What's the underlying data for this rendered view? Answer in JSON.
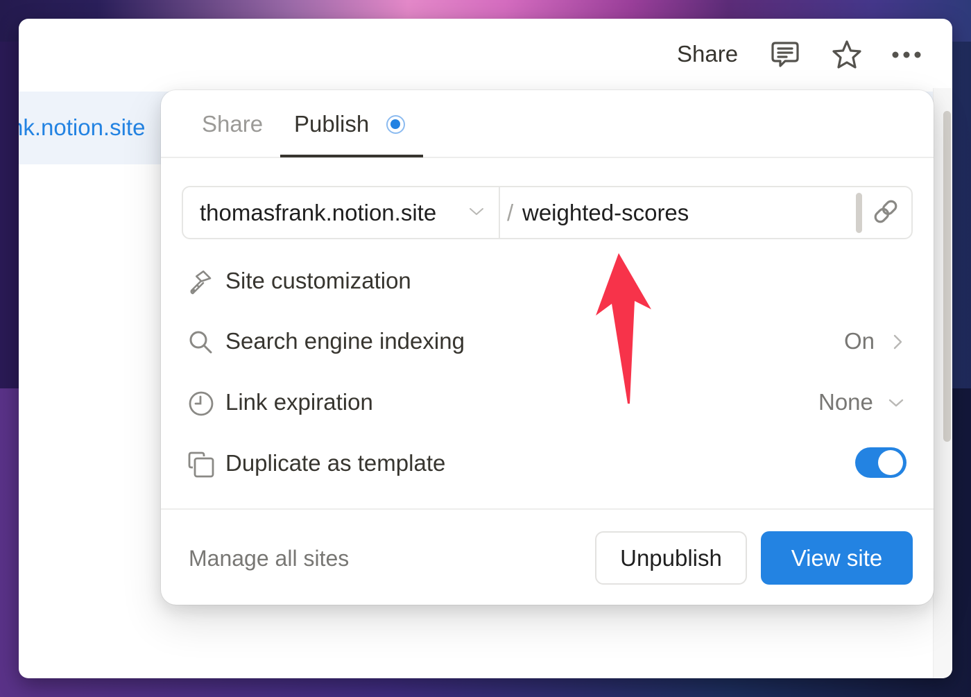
{
  "topbar": {
    "share_label": "Share",
    "icons": [
      "comment-icon",
      "star-icon",
      "more-icon"
    ]
  },
  "page": {
    "visible_link_fragment": "nk.notion.site"
  },
  "popover": {
    "tabs": [
      {
        "label": "Share",
        "active": false
      },
      {
        "label": "Publish",
        "active": true,
        "status": "published-indicator"
      }
    ],
    "url": {
      "domain": "thomasfrank.notion.site",
      "separator": "/",
      "slug": "weighted-scores",
      "copy_icon": "link-icon"
    },
    "options": [
      {
        "icon": "paintbrush-icon",
        "label": "Site customization"
      },
      {
        "icon": "search-icon",
        "label": "Search engine indexing",
        "value": "On",
        "control": "chevron-right"
      },
      {
        "icon": "clock-icon",
        "label": "Link expiration",
        "value": "None",
        "control": "chevron-down"
      },
      {
        "icon": "duplicate-icon",
        "label": "Duplicate as template",
        "toggle_on": true
      }
    ],
    "footer": {
      "manage_label": "Manage all sites",
      "unpublish_label": "Unpublish",
      "view_site_label": "View site"
    }
  },
  "colors": {
    "accent": "#2383e2",
    "text": "#37352f",
    "muted": "#787774",
    "annotation_arrow": "#f7334a"
  }
}
